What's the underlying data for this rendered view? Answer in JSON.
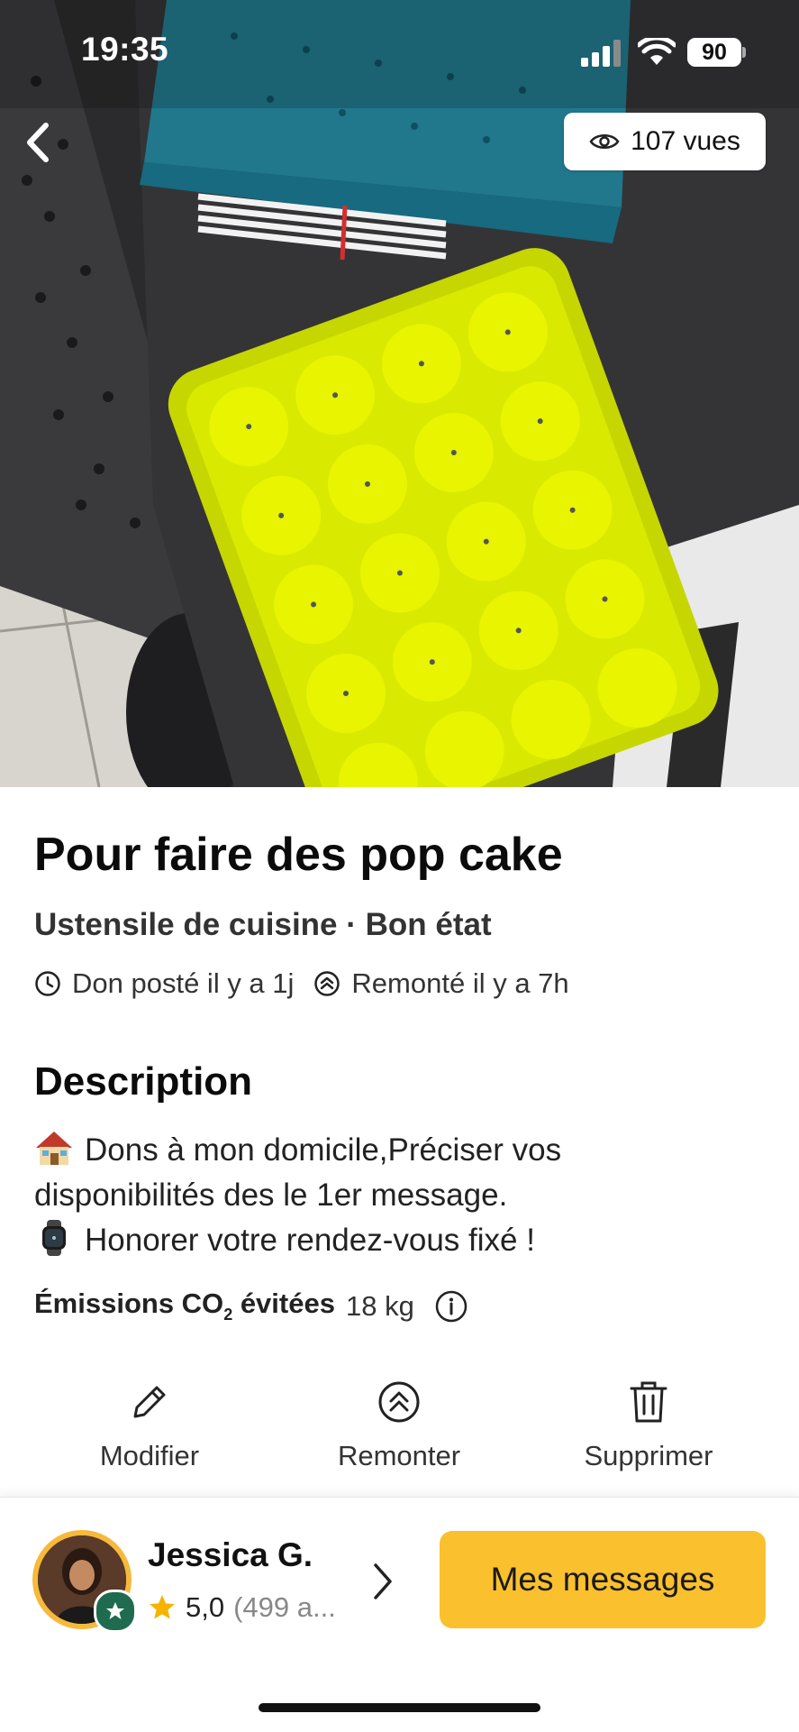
{
  "status_bar": {
    "time": "19:35",
    "battery": "90"
  },
  "header": {
    "views_label": "107 vues"
  },
  "listing": {
    "title": "Pour faire des pop cake",
    "subtitle": "Ustensile de cuisine · Bon état",
    "posted": "Don posté il y a 1j",
    "bumped": "Remonté il y a 7h"
  },
  "description": {
    "heading": "Description",
    "line1": "Dons à mon domicile,Préciser vos",
    "line2": "disponibilités des le 1er message.",
    "line3": "Honorer votre rendez-vous fixé !"
  },
  "co2": {
    "label_pre": "Émissions CO",
    "label_sub": "2",
    "label_post": " évitées",
    "value": "18 kg"
  },
  "actions": {
    "edit": "Modifier",
    "bump": "Remonter",
    "delete": "Supprimer"
  },
  "user": {
    "name": "Jessica G.",
    "rating": "5,0",
    "reviews": "(499 a..."
  },
  "cta": {
    "messages": "Mes messages"
  },
  "colors": {
    "accent": "#fbc02d",
    "mold": "#d6e600",
    "badge": "#1f6b4f"
  }
}
